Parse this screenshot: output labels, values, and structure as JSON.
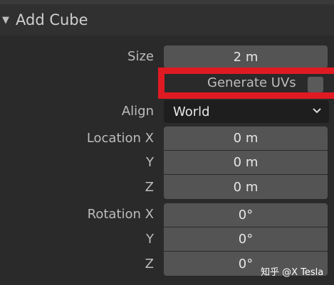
{
  "panel": {
    "title": "Add Cube"
  },
  "size": {
    "label": "Size",
    "value": "2 m"
  },
  "generate_uvs": {
    "label": "Generate UVs",
    "checked": false
  },
  "align": {
    "label": "Align",
    "value": "World"
  },
  "location": {
    "label_x": "Location X",
    "label_y": "Y",
    "label_z": "Z",
    "x": "0 m",
    "y": "0 m",
    "z": "0 m"
  },
  "rotation": {
    "label_x": "Rotation X",
    "label_y": "Y",
    "label_z": "Z",
    "x": "0°",
    "y": "0°",
    "z": "0°"
  },
  "watermark": "知乎 @X Tesla",
  "colors": {
    "highlight": "#e01a22",
    "field": "#545454",
    "background": "#282828"
  }
}
